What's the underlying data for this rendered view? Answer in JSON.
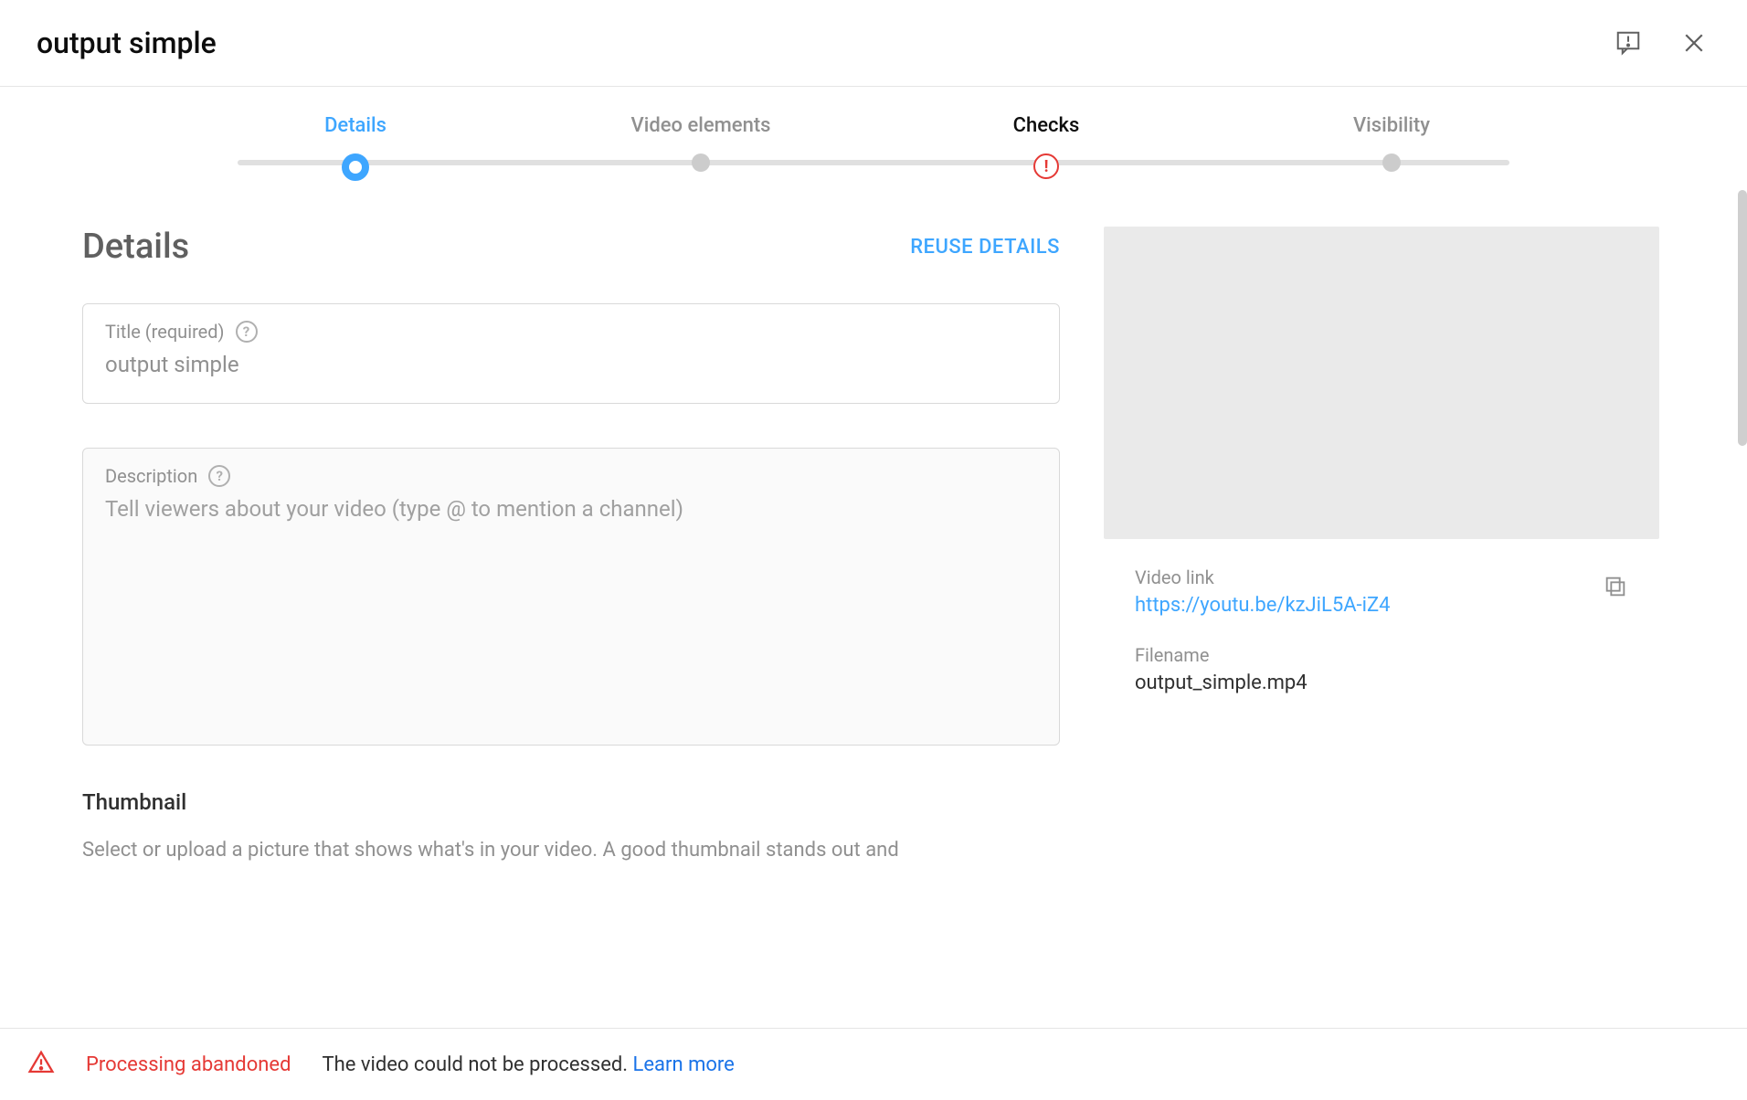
{
  "header": {
    "title": "output simple"
  },
  "stepper": {
    "steps": [
      {
        "label": "Details"
      },
      {
        "label": "Video elements"
      },
      {
        "label": "Checks"
      },
      {
        "label": "Visibility"
      }
    ]
  },
  "details": {
    "heading": "Details",
    "reuse": "REUSE DETAILS",
    "title_field": {
      "label": "Title (required)",
      "value": "output simple"
    },
    "description_field": {
      "label": "Description",
      "placeholder": "Tell viewers about your video (type @ to mention a channel)"
    },
    "thumbnail": {
      "heading": "Thumbnail",
      "desc": "Select or upload a picture that shows what's in your video. A good thumbnail stands out and"
    }
  },
  "sidebar": {
    "video_link_label": "Video link",
    "video_link": "https://youtu.be/kzJiL5A-iZ4",
    "filename_label": "Filename",
    "filename": "output_simple.mp4"
  },
  "footer": {
    "status": "Processing abandoned",
    "message": "The video could not be processed. ",
    "learn_more": "Learn more"
  }
}
